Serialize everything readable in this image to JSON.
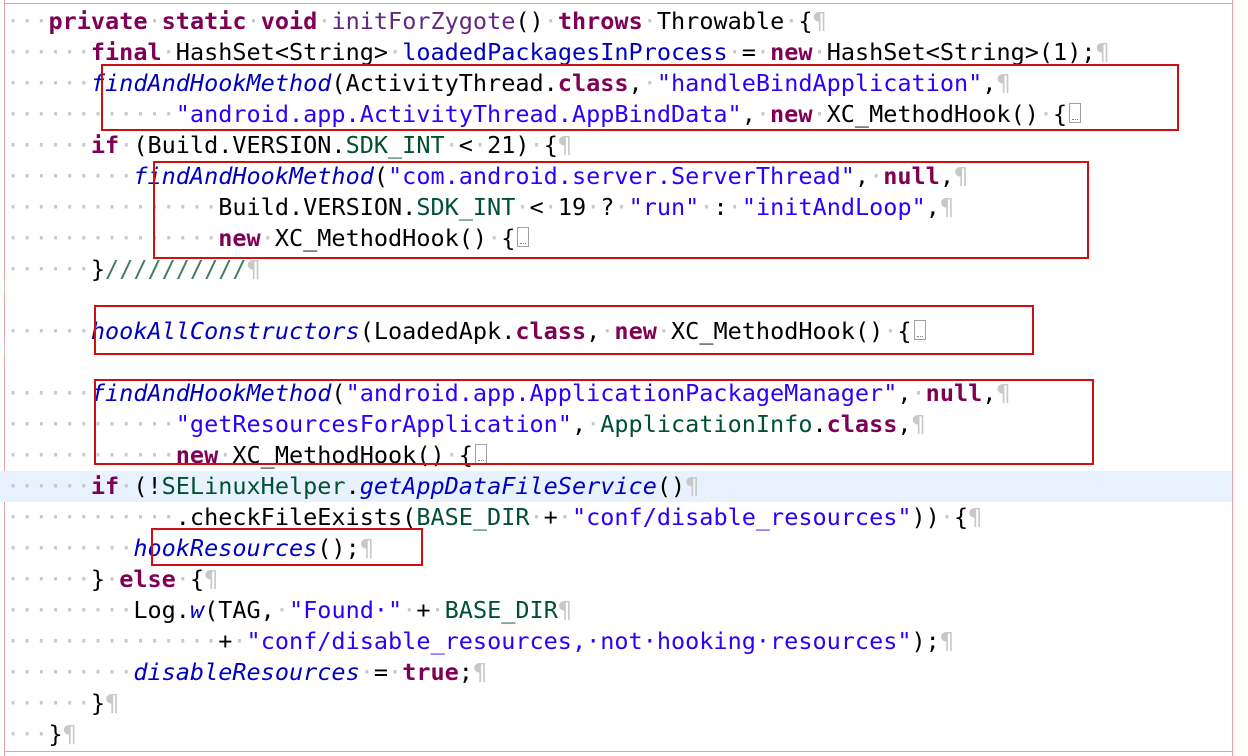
{
  "editor": {
    "lines": [
      {
        "id": "l1",
        "tokens": [
          {
            "t": "ws",
            "v": "···"
          },
          {
            "t": "kw",
            "v": "private"
          },
          {
            "t": "ws",
            "v": "·"
          },
          {
            "t": "kw",
            "v": "static"
          },
          {
            "t": "ws",
            "v": "·"
          },
          {
            "t": "kw",
            "v": "void"
          },
          {
            "t": "ws",
            "v": "·"
          },
          {
            "t": "mth",
            "v": "initForZygote"
          },
          {
            "t": "typ",
            "v": "()"
          },
          {
            "t": "ws",
            "v": "·"
          },
          {
            "t": "kw",
            "v": "throws"
          },
          {
            "t": "ws",
            "v": "·"
          },
          {
            "t": "typ",
            "v": "Throwable"
          },
          {
            "t": "ws",
            "v": "·"
          },
          {
            "t": "typ",
            "v": "{"
          },
          {
            "t": "ws",
            "v": "¶"
          }
        ]
      },
      {
        "id": "l2",
        "tokens": [
          {
            "t": "ws",
            "v": "······"
          },
          {
            "t": "kw",
            "v": "final"
          },
          {
            "t": "ws",
            "v": "·"
          },
          {
            "t": "typ",
            "v": "HashSet<String>"
          },
          {
            "t": "ws",
            "v": "·"
          },
          {
            "t": "fld",
            "v": "loadedPackagesInProcess"
          },
          {
            "t": "ws",
            "v": "·"
          },
          {
            "t": "typ",
            "v": "="
          },
          {
            "t": "ws",
            "v": "·"
          },
          {
            "t": "kw",
            "v": "new"
          },
          {
            "t": "ws",
            "v": "·"
          },
          {
            "t": "typ",
            "v": "HashSet<String>(1);"
          },
          {
            "t": "ws",
            "v": "¶"
          }
        ]
      },
      {
        "id": "l3",
        "tokens": [
          {
            "t": "ws",
            "v": "······"
          },
          {
            "t": "smth",
            "v": "findAndHookMethod"
          },
          {
            "t": "typ",
            "v": "(ActivityThread."
          },
          {
            "t": "kw",
            "v": "class"
          },
          {
            "t": "typ",
            "v": ","
          },
          {
            "t": "ws",
            "v": "·"
          },
          {
            "t": "str",
            "v": "\"handleBindApplication\""
          },
          {
            "t": "typ",
            "v": ","
          },
          {
            "t": "ws",
            "v": "¶"
          }
        ]
      },
      {
        "id": "l4",
        "tokens": [
          {
            "t": "ws",
            "v": "············"
          },
          {
            "t": "str",
            "v": "\"android.app.ActivityThread.AppBindData\""
          },
          {
            "t": "typ",
            "v": ","
          },
          {
            "t": "ws",
            "v": "·"
          },
          {
            "t": "kw",
            "v": "new"
          },
          {
            "t": "ws",
            "v": "·"
          },
          {
            "t": "typ",
            "v": "XC_MethodHook()"
          },
          {
            "t": "ws",
            "v": "·"
          },
          {
            "t": "typ",
            "v": "{"
          },
          {
            "t": "fold",
            "v": ""
          }
        ]
      },
      {
        "id": "l5",
        "tokens": [
          {
            "t": "ws",
            "v": "······"
          },
          {
            "t": "kw",
            "v": "if"
          },
          {
            "t": "ws",
            "v": "·"
          },
          {
            "t": "typ",
            "v": "(Build.VERSION."
          },
          {
            "t": "cls",
            "v": "SDK_INT"
          },
          {
            "t": "ws",
            "v": "·"
          },
          {
            "t": "typ",
            "v": "<"
          },
          {
            "t": "ws",
            "v": "·"
          },
          {
            "t": "typ",
            "v": "21)"
          },
          {
            "t": "ws",
            "v": "·"
          },
          {
            "t": "typ",
            "v": "{"
          },
          {
            "t": "ws",
            "v": "¶"
          }
        ]
      },
      {
        "id": "l6",
        "tokens": [
          {
            "t": "ws",
            "v": "·········"
          },
          {
            "t": "smth",
            "v": "findAndHookMethod"
          },
          {
            "t": "typ",
            "v": "("
          },
          {
            "t": "str",
            "v": "\"com.android.server.ServerThread\""
          },
          {
            "t": "typ",
            "v": ","
          },
          {
            "t": "ws",
            "v": "·"
          },
          {
            "t": "kw",
            "v": "null"
          },
          {
            "t": "typ",
            "v": ","
          },
          {
            "t": "ws",
            "v": "¶"
          }
        ]
      },
      {
        "id": "l7",
        "tokens": [
          {
            "t": "ws",
            "v": "···············"
          },
          {
            "t": "typ",
            "v": "Build.VERSION."
          },
          {
            "t": "cls",
            "v": "SDK_INT"
          },
          {
            "t": "ws",
            "v": "·"
          },
          {
            "t": "typ",
            "v": "<"
          },
          {
            "t": "ws",
            "v": "·"
          },
          {
            "t": "typ",
            "v": "19"
          },
          {
            "t": "ws",
            "v": "·"
          },
          {
            "t": "typ",
            "v": "?"
          },
          {
            "t": "ws",
            "v": "·"
          },
          {
            "t": "str",
            "v": "\"run\""
          },
          {
            "t": "ws",
            "v": "·"
          },
          {
            "t": "typ",
            "v": ":"
          },
          {
            "t": "ws",
            "v": "·"
          },
          {
            "t": "str",
            "v": "\"initAndLoop\""
          },
          {
            "t": "typ",
            "v": ","
          },
          {
            "t": "ws",
            "v": "¶"
          }
        ]
      },
      {
        "id": "l8",
        "tokens": [
          {
            "t": "ws",
            "v": "···············"
          },
          {
            "t": "kw",
            "v": "new"
          },
          {
            "t": "ws",
            "v": "·"
          },
          {
            "t": "typ",
            "v": "XC_MethodHook()"
          },
          {
            "t": "ws",
            "v": "·"
          },
          {
            "t": "typ",
            "v": "{"
          },
          {
            "t": "fold",
            "v": ""
          }
        ]
      },
      {
        "id": "l9",
        "tokens": [
          {
            "t": "ws",
            "v": "······"
          },
          {
            "t": "typ",
            "v": "}"
          },
          {
            "t": "cmt",
            "v": "//////////"
          },
          {
            "t": "ws",
            "v": "¶"
          }
        ]
      },
      {
        "id": "l10",
        "tokens": []
      },
      {
        "id": "l11",
        "tokens": [
          {
            "t": "ws",
            "v": "······"
          },
          {
            "t": "smth",
            "v": "hookAllConstructors"
          },
          {
            "t": "typ",
            "v": "(LoadedApk."
          },
          {
            "t": "kw",
            "v": "class"
          },
          {
            "t": "typ",
            "v": ","
          },
          {
            "t": "ws",
            "v": "·"
          },
          {
            "t": "kw",
            "v": "new"
          },
          {
            "t": "ws",
            "v": "·"
          },
          {
            "t": "typ",
            "v": "XC_MethodHook()"
          },
          {
            "t": "ws",
            "v": "·"
          },
          {
            "t": "typ",
            "v": "{"
          },
          {
            "t": "fold",
            "v": ""
          }
        ]
      },
      {
        "id": "l12",
        "tokens": []
      },
      {
        "id": "l13",
        "tokens": [
          {
            "t": "ws",
            "v": "······"
          },
          {
            "t": "smth",
            "v": "findAndHookMethod"
          },
          {
            "t": "typ",
            "v": "("
          },
          {
            "t": "str",
            "v": "\"android.app.ApplicationPackageManager\""
          },
          {
            "t": "typ",
            "v": ","
          },
          {
            "t": "ws",
            "v": "·"
          },
          {
            "t": "kw",
            "v": "null"
          },
          {
            "t": "typ",
            "v": ","
          },
          {
            "t": "ws",
            "v": "¶"
          }
        ]
      },
      {
        "id": "l14",
        "tokens": [
          {
            "t": "ws",
            "v": "············"
          },
          {
            "t": "str",
            "v": "\"getResourcesForApplication\""
          },
          {
            "t": "typ",
            "v": ","
          },
          {
            "t": "ws",
            "v": "·"
          },
          {
            "t": "cls",
            "v": "ApplicationInfo"
          },
          {
            "t": "typ",
            "v": "."
          },
          {
            "t": "kw",
            "v": "class"
          },
          {
            "t": "typ",
            "v": ","
          },
          {
            "t": "ws",
            "v": "¶"
          }
        ]
      },
      {
        "id": "l15",
        "tokens": [
          {
            "t": "ws",
            "v": "············"
          },
          {
            "t": "kw",
            "v": "new"
          },
          {
            "t": "ws",
            "v": "·"
          },
          {
            "t": "typ",
            "v": "XC_MethodHook()"
          },
          {
            "t": "ws",
            "v": "·"
          },
          {
            "t": "typ",
            "v": "{"
          },
          {
            "t": "fold",
            "v": ""
          }
        ]
      },
      {
        "id": "l16",
        "current": true,
        "tokens": [
          {
            "t": "ws",
            "v": "······"
          },
          {
            "t": "kw",
            "v": "if"
          },
          {
            "t": "ws",
            "v": "·"
          },
          {
            "t": "typ",
            "v": "(!"
          },
          {
            "t": "cls",
            "v": "SELinuxHelper"
          },
          {
            "t": "typ",
            "v": "."
          },
          {
            "t": "smth",
            "v": "getAppDataFileService"
          },
          {
            "t": "typ",
            "v": "()"
          },
          {
            "t": "ws",
            "v": "¶"
          }
        ]
      },
      {
        "id": "l17",
        "tokens": [
          {
            "t": "ws",
            "v": "············"
          },
          {
            "t": "typ",
            "v": ".checkFileExists("
          },
          {
            "t": "cls",
            "v": "BASE_DIR"
          },
          {
            "t": "ws",
            "v": "·"
          },
          {
            "t": "typ",
            "v": "+"
          },
          {
            "t": "ws",
            "v": "·"
          },
          {
            "t": "str",
            "v": "\"conf/disable_resources\""
          },
          {
            "t": "typ",
            "v": "))"
          },
          {
            "t": "ws",
            "v": "·"
          },
          {
            "t": "typ",
            "v": "{"
          },
          {
            "t": "ws",
            "v": "¶"
          }
        ]
      },
      {
        "id": "l18",
        "tokens": [
          {
            "t": "ws",
            "v": "·········"
          },
          {
            "t": "smth",
            "v": "hookResources"
          },
          {
            "t": "typ",
            "v": "();"
          },
          {
            "t": "ws",
            "v": "¶"
          }
        ]
      },
      {
        "id": "l19",
        "tokens": [
          {
            "t": "ws",
            "v": "······"
          },
          {
            "t": "typ",
            "v": "}"
          },
          {
            "t": "ws",
            "v": "·"
          },
          {
            "t": "kw",
            "v": "else"
          },
          {
            "t": "ws",
            "v": "·"
          },
          {
            "t": "typ",
            "v": "{"
          },
          {
            "t": "ws",
            "v": "¶"
          }
        ]
      },
      {
        "id": "l20",
        "tokens": [
          {
            "t": "ws",
            "v": "·········"
          },
          {
            "t": "typ",
            "v": "Log."
          },
          {
            "t": "smth",
            "v": "w"
          },
          {
            "t": "typ",
            "v": "(TAG,"
          },
          {
            "t": "ws",
            "v": "·"
          },
          {
            "t": "str",
            "v": "\"Found·\""
          },
          {
            "t": "ws",
            "v": "·"
          },
          {
            "t": "typ",
            "v": "+"
          },
          {
            "t": "ws",
            "v": "·"
          },
          {
            "t": "cls",
            "v": "BASE_DIR"
          },
          {
            "t": "ws",
            "v": "¶"
          }
        ]
      },
      {
        "id": "l21",
        "tokens": [
          {
            "t": "ws",
            "v": "···············"
          },
          {
            "t": "typ",
            "v": "+"
          },
          {
            "t": "ws",
            "v": "·"
          },
          {
            "t": "str",
            "v": "\"conf/disable_resources,·not·hooking·resources\""
          },
          {
            "t": "typ",
            "v": ");"
          },
          {
            "t": "ws",
            "v": "¶"
          }
        ]
      },
      {
        "id": "l22",
        "tokens": [
          {
            "t": "ws",
            "v": "·········"
          },
          {
            "t": "sfld",
            "v": "disableResources"
          },
          {
            "t": "ws",
            "v": "·"
          },
          {
            "t": "typ",
            "v": "="
          },
          {
            "t": "ws",
            "v": "·"
          },
          {
            "t": "kw",
            "v": "true"
          },
          {
            "t": "typ",
            "v": ";"
          },
          {
            "t": "ws",
            "v": "¶"
          }
        ]
      },
      {
        "id": "l23",
        "tokens": [
          {
            "t": "ws",
            "v": "······"
          },
          {
            "t": "typ",
            "v": "}"
          },
          {
            "t": "ws",
            "v": "¶"
          }
        ]
      },
      {
        "id": "l24",
        "tokens": [
          {
            "t": "ws",
            "v": "···"
          },
          {
            "t": "typ",
            "v": "}"
          },
          {
            "t": "ws",
            "v": "¶"
          }
        ]
      }
    ],
    "highlight_color": "#d01010",
    "current_line_color": "#e8f2fe"
  }
}
